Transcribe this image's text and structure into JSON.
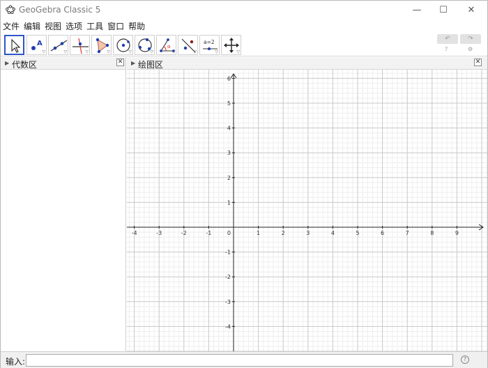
{
  "window": {
    "title": "GeoGebra Classic 5",
    "minimize_glyph": "—",
    "maximize_glyph": "☐",
    "close_glyph": "✕"
  },
  "menu": [
    "文件",
    "编辑",
    "视图",
    "选项",
    "工具",
    "窗口",
    "帮助"
  ],
  "toolbar": {
    "tools": [
      {
        "name": "move-tool",
        "icon": "arrow-cursor-icon",
        "selected": true
      },
      {
        "name": "point-tool",
        "icon": "point-a-icon"
      },
      {
        "name": "line-tool",
        "icon": "line-icon"
      },
      {
        "name": "perpendicular-line-tool",
        "icon": "perpendicular-icon"
      },
      {
        "name": "polygon-tool",
        "icon": "polygon-icon"
      },
      {
        "name": "circle-tool",
        "icon": "circle-center-icon"
      },
      {
        "name": "circle-three-points-tool",
        "icon": "circle-three-points-icon"
      },
      {
        "name": "angle-tool",
        "icon": "angle-icon"
      },
      {
        "name": "reflect-tool",
        "icon": "reflect-icon"
      },
      {
        "name": "slider-tool",
        "icon": "slider-icon",
        "label": "a=2"
      },
      {
        "name": "move-graphics-tool",
        "icon": "move-cross-icon"
      }
    ],
    "undo_glyph": "↶",
    "redo_glyph": "↷",
    "help_glyph": "?",
    "settings_glyph": "⚙"
  },
  "algebra_view": {
    "title": "代数区",
    "close_glyph": "✕"
  },
  "graphics_view": {
    "title": "绘图区",
    "close_glyph": "✕",
    "origin_label": "0",
    "x_ticks": [
      "-4",
      "-3",
      "-2",
      "-1",
      "1",
      "2",
      "3",
      "4",
      "5",
      "6",
      "7",
      "8",
      "9"
    ],
    "y_ticks": [
      "6",
      "5",
      "4",
      "3",
      "2",
      "1",
      "-1",
      "-2",
      "-3",
      "-4"
    ],
    "colors": {
      "grid_minor": "#eeeeee",
      "grid_major": "#c8c8c8",
      "axis": "#222222"
    }
  },
  "input_bar": {
    "label": "输入:",
    "value": "",
    "help_glyph": "?"
  }
}
